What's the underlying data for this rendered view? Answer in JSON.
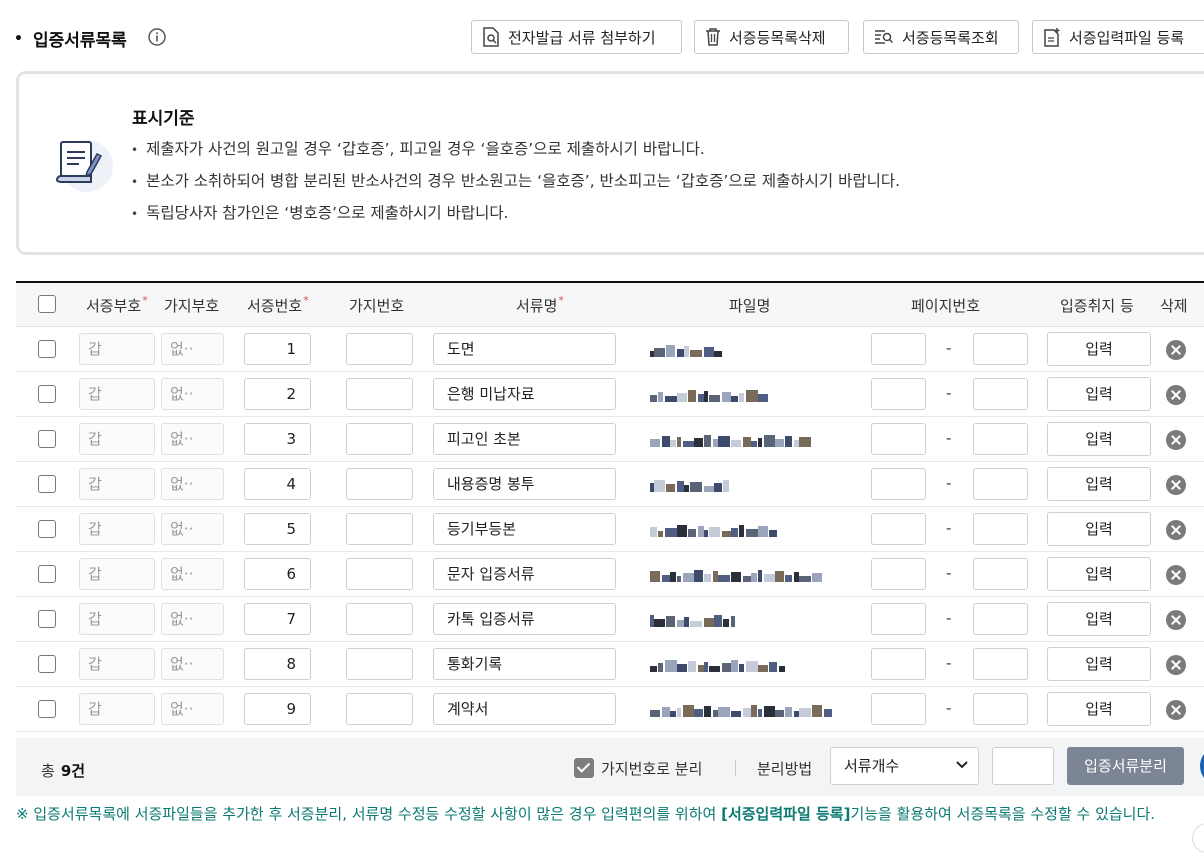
{
  "section": {
    "title": "입증서류목록",
    "bullet": "•"
  },
  "toolbar": [
    {
      "label": "전자발급 서류 첨부하기",
      "icon": "document-attach-icon"
    },
    {
      "label": "서증등목록삭제",
      "icon": "trash-icon"
    },
    {
      "label": "서증등목록조회",
      "icon": "list-search-icon"
    },
    {
      "label": "서증입력파일 등록",
      "icon": "file-add-icon"
    }
  ],
  "notice": {
    "title": "표시기준",
    "icon": "document-scroll-icon",
    "items": [
      "제출자가 사건의 원고일 경우 ‘갑호증’, 피고일 경우 ‘을호증’으로 제출하시기 바랍니다.",
      "본소가 소취하되어 병합 분리된 반소사건의 경우 반소원고는 ‘을호증’, 반소피고는 ‘갑호증’으로 제출하시기 바랍니다.",
      "독립당사자 참가인은 ‘병호증’으로 제출하시기 바랍니다."
    ]
  },
  "table": {
    "headers": {
      "evidence_code": "서증부호",
      "branch_code": "가지부호",
      "evidence_no": "서증번호",
      "branch_no": "가지번호",
      "doc_name": "서류명",
      "file_name": "파일명",
      "page_no": "페이지번호",
      "purpose": "입증취지 등",
      "delete": "삭제"
    },
    "rows": [
      {
        "code": "갑",
        "branch": "없··",
        "no": "1",
        "branch_no": "",
        "name": "도면",
        "page_from": "",
        "page_to": "",
        "purpose_btn": "입력"
      },
      {
        "code": "갑",
        "branch": "없··",
        "no": "2",
        "branch_no": "",
        "name": "은행 미납자료",
        "page_from": "",
        "page_to": "",
        "purpose_btn": "입력"
      },
      {
        "code": "갑",
        "branch": "없··",
        "no": "3",
        "branch_no": "",
        "name": "피고인 초본",
        "page_from": "",
        "page_to": "",
        "purpose_btn": "입력"
      },
      {
        "code": "갑",
        "branch": "없··",
        "no": "4",
        "branch_no": "",
        "name": "내용증명 봉투",
        "page_from": "",
        "page_to": "",
        "purpose_btn": "입력"
      },
      {
        "code": "갑",
        "branch": "없··",
        "no": "5",
        "branch_no": "",
        "name": "등기부등본",
        "page_from": "",
        "page_to": "",
        "purpose_btn": "입력"
      },
      {
        "code": "갑",
        "branch": "없··",
        "no": "6",
        "branch_no": "",
        "name": "문자 입증서류",
        "page_from": "",
        "page_to": "",
        "purpose_btn": "입력"
      },
      {
        "code": "갑",
        "branch": "없··",
        "no": "7",
        "branch_no": "",
        "name": "카톡 입증서류",
        "page_from": "",
        "page_to": "",
        "purpose_btn": "입력"
      },
      {
        "code": "갑",
        "branch": "없··",
        "no": "8",
        "branch_no": "",
        "name": "통화기록",
        "page_from": "",
        "page_to": "",
        "purpose_btn": "입력"
      },
      {
        "code": "갑",
        "branch": "없··",
        "no": "9",
        "branch_no": "",
        "name": "계약서",
        "page_from": "",
        "page_to": "",
        "purpose_btn": "입력"
      }
    ]
  },
  "footer": {
    "total_label": "총",
    "total_count": "9건",
    "split_checkbox_label": "가지번호로 분리",
    "split_method_label": "분리방법",
    "split_method_value": "서류개수",
    "split_count_value": "",
    "split_button": "입증서류분리"
  },
  "footnote": {
    "part1": "※ 입증서류목록에 서증파일들을 추가한 후 서증분리, 서류명 수정등 수정할 사항이 많은 경우 입력편의를 위하여 ",
    "highlight": "[서증입력파일 등록]",
    "part2": "기능을 활용하여 서증목록을 수정할 수 있습니다."
  },
  "colors": {
    "accent_gray_button": "#7b8595",
    "footnote_teal": "#0b7a72",
    "required_red": "#e34a4a"
  }
}
